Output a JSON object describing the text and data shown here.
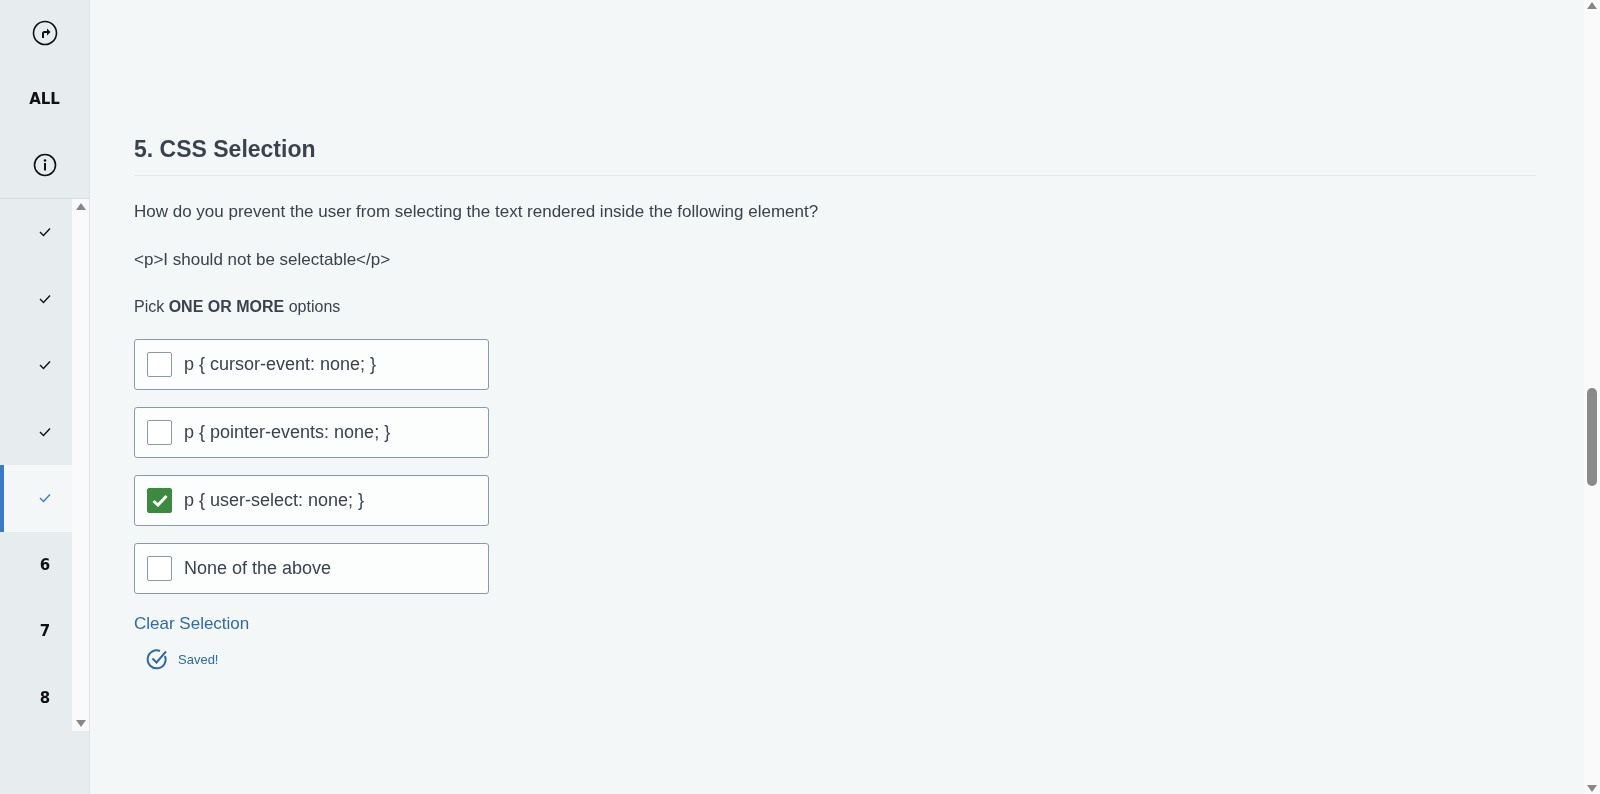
{
  "sidebar": {
    "top_items": [
      {
        "kind": "icon"
      },
      {
        "kind": "text",
        "label": "ALL"
      },
      {
        "kind": "info"
      }
    ],
    "questions": [
      {
        "kind": "done",
        "selected": false
      },
      {
        "kind": "done",
        "selected": false
      },
      {
        "kind": "done",
        "selected": false
      },
      {
        "kind": "done",
        "selected": false
      },
      {
        "kind": "done",
        "selected": true
      },
      {
        "kind": "number",
        "label": "6",
        "selected": false
      },
      {
        "kind": "number",
        "label": "7",
        "selected": false
      },
      {
        "kind": "number",
        "label": "8",
        "selected": false
      }
    ]
  },
  "question": {
    "title": "5. CSS Selection",
    "prompt": "How do you prevent the user from selecting the text rendered inside the following element?",
    "code": "<p>I should not be selectable</p>",
    "instruction": "Pick **ONE OR MORE** options",
    "options": [
      {
        "label": "p { cursor-event: none; }",
        "checked": false
      },
      {
        "label": "p { pointer-events: none; }",
        "checked": false
      },
      {
        "label": "p { user-select: none; }",
        "checked": true
      },
      {
        "label": "None of the above",
        "checked": false
      }
    ],
    "clear_link": "Clear Selection",
    "status": "Saved!"
  }
}
